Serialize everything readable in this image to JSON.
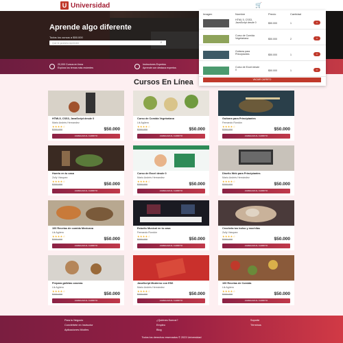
{
  "header": {
    "logo_letter": "U",
    "brand": "Universidad",
    "cart_icon": "cart-icon"
  },
  "hero": {
    "title": "Aprende algo diferente",
    "subtitle": "Todos los cursos a $50.000",
    "search_placeholder": "Que te gustaría Aprender"
  },
  "features": [
    {
      "line1": "20,000 Cursos en línea",
      "line2": "Explora los temas más recientes"
    },
    {
      "line1": "Instructores Expertos",
      "line2": "Aprende con destaca expertos"
    }
  ],
  "cart": {
    "headers": [
      "Imagen",
      "Nombre",
      "Precio",
      "Cantidad"
    ],
    "items": [
      {
        "name": "HTML 5, CSS3, JavaScript desde 0",
        "price": "$50.000",
        "qty": "1"
      },
      {
        "name": "Curso de Comida Vegetariana",
        "price": "$50.000",
        "qty": "2"
      },
      {
        "name": "Guitarra para Principiantes",
        "price": "$50.000",
        "qty": "1"
      },
      {
        "name": "Curso de Excel desde 0",
        "price": "$50.000",
        "qty": "1"
      }
    ],
    "delete_symbol": "×",
    "empty_label": "VACIAR CARRITO"
  },
  "section_title": "Cursos En Línea",
  "courses": [
    {
      "title": "HTML5, CSS3, JavaScript desde 0",
      "author": "Mario Andrés Hernandez",
      "old_price": "$200.000",
      "price": "$50.000"
    },
    {
      "title": "Curso de Comida Vegetariana",
      "author": "Lik Agüero",
      "old_price": "$200.000",
      "price": "$50.000"
    },
    {
      "title": "Guitarra para Principiantes",
      "author": "Fernando Rondón",
      "old_price": "$200.000",
      "price": "$50.000"
    },
    {
      "title": "Huerto en tu casa",
      "author": "Zully Vásquez",
      "old_price": "$200.000",
      "price": "$50.000"
    },
    {
      "title": "Curso de Excel desde 0",
      "author": "Mario Andrés Hernandez",
      "old_price": "$200.000",
      "price": "$50.000"
    },
    {
      "title": "Diseño Web para Principiantes",
      "author": "Mario Andrés Hernández",
      "old_price": "$200.000",
      "price": "$50.000"
    },
    {
      "title": "100 Recetas de comida Mexicana",
      "author": "Lik Agüero",
      "old_price": "$200.000",
      "price": "$50.000"
    },
    {
      "title": "Estudio Musical en tu casa",
      "author": "Fernando Rondón",
      "old_price": "$200.000",
      "price": "$50.000"
    },
    {
      "title": "Crocheta tus bolso y mochilas",
      "author": "Zully Vásquez",
      "old_price": "$200.000",
      "price": "$50.000"
    },
    {
      "title": "Prepara galletas caseras",
      "author": "Lik Agüero",
      "old_price": "$200.000",
      "price": "$50.000"
    },
    {
      "title": "JavaScript Moderno con ES6",
      "author": "Mario Andrés Hernández",
      "old_price": "$200.000",
      "price": "$50.000"
    },
    {
      "title": "100 Recetas de Comida",
      "author": "Lik Agüero",
      "old_price": "$200.000",
      "price": "$50.000"
    }
  ],
  "stars": "★★★★☆",
  "add_to_cart_label": "AGREGAR AL CARRITO",
  "footer": {
    "col1": [
      "Para tu Negocio",
      "Conviértete en Instructor",
      "Aplicaciones Móviles"
    ],
    "col2": [
      "¿Quiénes Somos?",
      "Empleo",
      "Blog"
    ],
    "col3": [
      "Soporte",
      "Términos"
    ],
    "copyright": "Todos los derechos reservados © 2023 Universidad"
  },
  "colors": {
    "brand": "#a31f34",
    "accent": "#c0392b",
    "footer_start": "#7a1e40",
    "footer_end": "#d13a45"
  }
}
